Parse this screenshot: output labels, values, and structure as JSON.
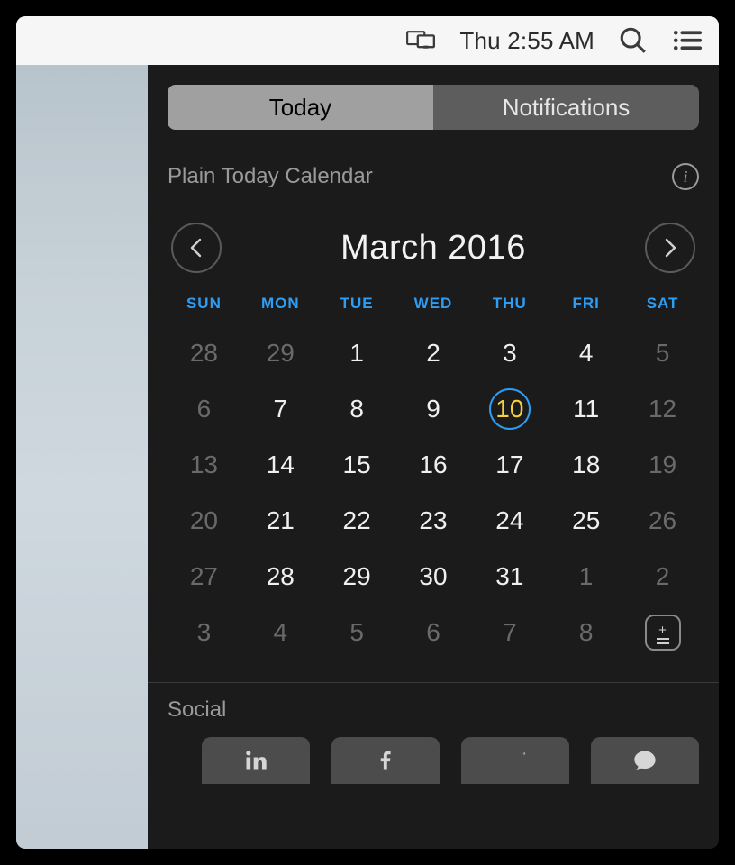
{
  "menubar": {
    "clock": "Thu 2:55 AM"
  },
  "tabs": {
    "today": "Today",
    "notifications": "Notifications"
  },
  "widget": {
    "title": "Plain Today Calendar"
  },
  "calendar": {
    "title": "March 2016",
    "dow": [
      "SUN",
      "MON",
      "TUE",
      "WED",
      "THU",
      "FRI",
      "SAT"
    ],
    "today": 10,
    "weeks": [
      [
        {
          "n": 28,
          "in": false
        },
        {
          "n": 29,
          "in": false
        },
        {
          "n": 1,
          "in": true
        },
        {
          "n": 2,
          "in": true
        },
        {
          "n": 3,
          "in": true
        },
        {
          "n": 4,
          "in": true
        },
        {
          "n": 5,
          "in": true
        }
      ],
      [
        {
          "n": 6,
          "in": true
        },
        {
          "n": 7,
          "in": true
        },
        {
          "n": 8,
          "in": true
        },
        {
          "n": 9,
          "in": true
        },
        {
          "n": 10,
          "in": true
        },
        {
          "n": 11,
          "in": true
        },
        {
          "n": 12,
          "in": true
        }
      ],
      [
        {
          "n": 13,
          "in": true
        },
        {
          "n": 14,
          "in": true
        },
        {
          "n": 15,
          "in": true
        },
        {
          "n": 16,
          "in": true
        },
        {
          "n": 17,
          "in": true
        },
        {
          "n": 18,
          "in": true
        },
        {
          "n": 19,
          "in": true
        }
      ],
      [
        {
          "n": 20,
          "in": true
        },
        {
          "n": 21,
          "in": true
        },
        {
          "n": 22,
          "in": true
        },
        {
          "n": 23,
          "in": true
        },
        {
          "n": 24,
          "in": true
        },
        {
          "n": 25,
          "in": true
        },
        {
          "n": 26,
          "in": true
        }
      ],
      [
        {
          "n": 27,
          "in": true
        },
        {
          "n": 28,
          "in": true
        },
        {
          "n": 29,
          "in": true
        },
        {
          "n": 30,
          "in": true
        },
        {
          "n": 31,
          "in": true
        },
        {
          "n": 1,
          "in": false
        },
        {
          "n": 2,
          "in": false
        }
      ],
      [
        {
          "n": 3,
          "in": false
        },
        {
          "n": 4,
          "in": false
        },
        {
          "n": 5,
          "in": false
        },
        {
          "n": 6,
          "in": false
        },
        {
          "n": 7,
          "in": false
        },
        {
          "n": 8,
          "in": false
        },
        {
          "n": null,
          "in": false,
          "edit": true
        }
      ]
    ]
  },
  "dimmed_cols": {
    "first": 0,
    "last": 6
  },
  "social": {
    "title": "Social",
    "buttons": [
      "linkedin",
      "facebook",
      "twitter",
      "messages"
    ]
  },
  "colors": {
    "accent_blue": "#2e9df4",
    "today_text": "#f4d03f"
  }
}
